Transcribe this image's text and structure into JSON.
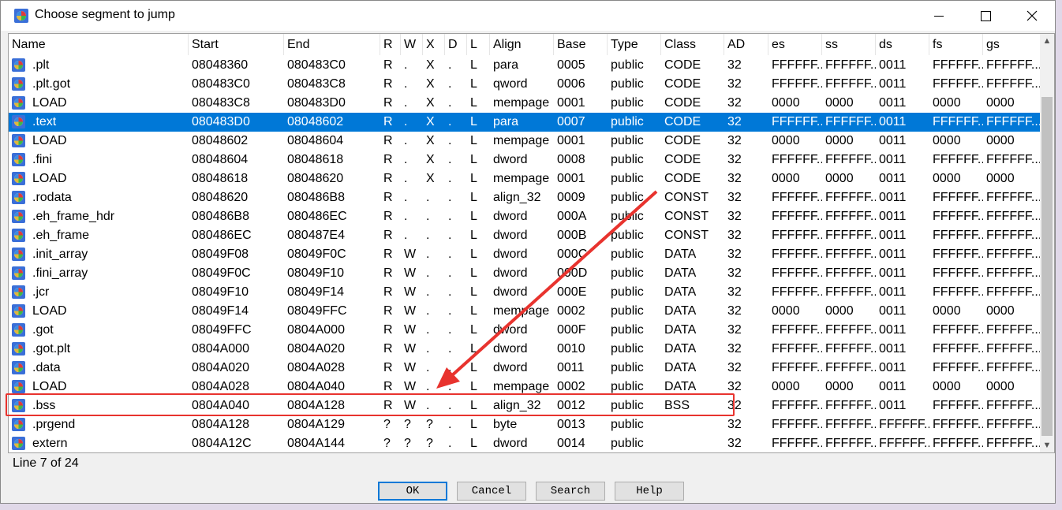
{
  "window": {
    "title": "Choose segment to jump"
  },
  "columns": [
    "Name",
    "Start",
    "End",
    "R",
    "W",
    "X",
    "D",
    "L",
    "Align",
    "Base",
    "Type",
    "Class",
    "AD",
    "es",
    "ss",
    "ds",
    "fs",
    "gs"
  ],
  "rows": [
    [
      ".plt",
      "08048360",
      "080483C0",
      "R",
      ".",
      "X",
      ".",
      "L",
      "para",
      "0005",
      "public",
      "CODE",
      "32",
      "FFFFFF...",
      "FFFFFF...",
      "0011",
      "FFFFFF...",
      "FFFFFF..."
    ],
    [
      ".plt.got",
      "080483C0",
      "080483C8",
      "R",
      ".",
      "X",
      ".",
      "L",
      "qword",
      "0006",
      "public",
      "CODE",
      "32",
      "FFFFFF...",
      "FFFFFF...",
      "0011",
      "FFFFFF...",
      "FFFFFF..."
    ],
    [
      "LOAD",
      "080483C8",
      "080483D0",
      "R",
      ".",
      "X",
      ".",
      "L",
      "mempage",
      "0001",
      "public",
      "CODE",
      "32",
      "0000",
      "0000",
      "0011",
      "0000",
      "0000"
    ],
    [
      ".text",
      "080483D0",
      "08048602",
      "R",
      ".",
      "X",
      ".",
      "L",
      "para",
      "0007",
      "public",
      "CODE",
      "32",
      "FFFFFF...",
      "FFFFFF...",
      "0011",
      "FFFFFF...",
      "FFFFFF..."
    ],
    [
      "LOAD",
      "08048602",
      "08048604",
      "R",
      ".",
      "X",
      ".",
      "L",
      "mempage",
      "0001",
      "public",
      "CODE",
      "32",
      "0000",
      "0000",
      "0011",
      "0000",
      "0000"
    ],
    [
      ".fini",
      "08048604",
      "08048618",
      "R",
      ".",
      "X",
      ".",
      "L",
      "dword",
      "0008",
      "public",
      "CODE",
      "32",
      "FFFFFF...",
      "FFFFFF...",
      "0011",
      "FFFFFF...",
      "FFFFFF..."
    ],
    [
      "LOAD",
      "08048618",
      "08048620",
      "R",
      ".",
      "X",
      ".",
      "L",
      "mempage",
      "0001",
      "public",
      "CODE",
      "32",
      "0000",
      "0000",
      "0011",
      "0000",
      "0000"
    ],
    [
      ".rodata",
      "08048620",
      "080486B8",
      "R",
      ".",
      ".",
      ".",
      "L",
      "align_32",
      "0009",
      "public",
      "CONST",
      "32",
      "FFFFFF...",
      "FFFFFF...",
      "0011",
      "FFFFFF...",
      "FFFFFF..."
    ],
    [
      ".eh_frame_hdr",
      "080486B8",
      "080486EC",
      "R",
      ".",
      ".",
      ".",
      "L",
      "dword",
      "000A",
      "public",
      "CONST",
      "32",
      "FFFFFF...",
      "FFFFFF...",
      "0011",
      "FFFFFF...",
      "FFFFFF..."
    ],
    [
      ".eh_frame",
      "080486EC",
      "080487E4",
      "R",
      ".",
      ".",
      ".",
      "L",
      "dword",
      "000B",
      "public",
      "CONST",
      "32",
      "FFFFFF...",
      "FFFFFF...",
      "0011",
      "FFFFFF...",
      "FFFFFF..."
    ],
    [
      ".init_array",
      "08049F08",
      "08049F0C",
      "R",
      "W",
      ".",
      ".",
      "L",
      "dword",
      "000C",
      "public",
      "DATA",
      "32",
      "FFFFFF...",
      "FFFFFF...",
      "0011",
      "FFFFFF...",
      "FFFFFF..."
    ],
    [
      ".fini_array",
      "08049F0C",
      "08049F10",
      "R",
      "W",
      ".",
      ".",
      "L",
      "dword",
      "000D",
      "public",
      "DATA",
      "32",
      "FFFFFF...",
      "FFFFFF...",
      "0011",
      "FFFFFF...",
      "FFFFFF..."
    ],
    [
      ".jcr",
      "08049F10",
      "08049F14",
      "R",
      "W",
      ".",
      ".",
      "L",
      "dword",
      "000E",
      "public",
      "DATA",
      "32",
      "FFFFFF...",
      "FFFFFF...",
      "0011",
      "FFFFFF...",
      "FFFFFF..."
    ],
    [
      "LOAD",
      "08049F14",
      "08049FFC",
      "R",
      "W",
      ".",
      ".",
      "L",
      "mempage",
      "0002",
      "public",
      "DATA",
      "32",
      "0000",
      "0000",
      "0011",
      "0000",
      "0000"
    ],
    [
      ".got",
      "08049FFC",
      "0804A000",
      "R",
      "W",
      ".",
      ".",
      "L",
      "dword",
      "000F",
      "public",
      "DATA",
      "32",
      "FFFFFF...",
      "FFFFFF...",
      "0011",
      "FFFFFF...",
      "FFFFFF..."
    ],
    [
      ".got.plt",
      "0804A000",
      "0804A020",
      "R",
      "W",
      ".",
      ".",
      "L",
      "dword",
      "0010",
      "public",
      "DATA",
      "32",
      "FFFFFF...",
      "FFFFFF...",
      "0011",
      "FFFFFF...",
      "FFFFFF..."
    ],
    [
      ".data",
      "0804A020",
      "0804A028",
      "R",
      "W",
      ".",
      ".",
      "L",
      "dword",
      "0011",
      "public",
      "DATA",
      "32",
      "FFFFFF...",
      "FFFFFF...",
      "0011",
      "FFFFFF...",
      "FFFFFF..."
    ],
    [
      "LOAD",
      "0804A028",
      "0804A040",
      "R",
      "W",
      ".",
      ".",
      "L",
      "mempage",
      "0002",
      "public",
      "DATA",
      "32",
      "0000",
      "0000",
      "0011",
      "0000",
      "0000"
    ],
    [
      ".bss",
      "0804A040",
      "0804A128",
      "R",
      "W",
      ".",
      ".",
      "L",
      "align_32",
      "0012",
      "public",
      "BSS",
      "32",
      "FFFFFF...",
      "FFFFFF...",
      "0011",
      "FFFFFF...",
      "FFFFFF..."
    ],
    [
      ".prgend",
      "0804A128",
      "0804A129",
      "?",
      "?",
      "?",
      ".",
      "L",
      "byte",
      "0013",
      "public",
      "",
      "32",
      "FFFFFF...",
      "FFFFFF...",
      "FFFFFF...",
      "FFFFFF...",
      "FFFFFF..."
    ],
    [
      "extern",
      "0804A12C",
      "0804A144",
      "?",
      "?",
      "?",
      ".",
      "L",
      "dword",
      "0014",
      "public",
      "",
      "32",
      "FFFFFF...",
      "FFFFFF...",
      "FFFFFF...",
      "FFFFFF...",
      "FFFFFF..."
    ]
  ],
  "selected_index": 3,
  "highlighted_index": 18,
  "status": {
    "text": "Line 7 of 24"
  },
  "buttons": {
    "ok": "OK",
    "cancel": "Cancel",
    "search": "Search",
    "help": "Help"
  },
  "colors": {
    "selection": "#0078d7",
    "annotation": "#e8332e"
  },
  "icons": {
    "app": "ida-segment-icon",
    "row": "segment-icon",
    "minimize": "minimize-icon",
    "maximize": "maximize-icon",
    "close": "close-icon"
  }
}
